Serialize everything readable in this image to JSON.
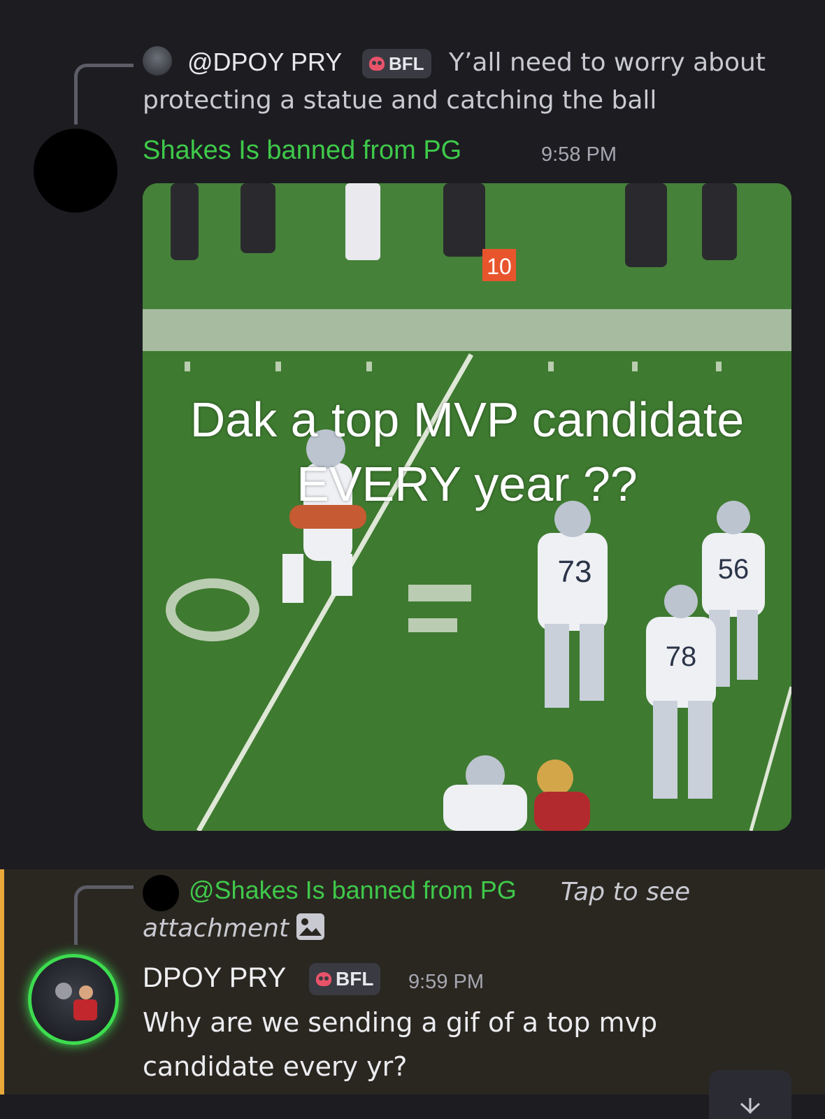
{
  "reply1": {
    "author": "@DPOY PRY",
    "badge": "BFL",
    "text_line1": "Y’all need to worry about",
    "text_line2": "protecting a statue and catching the ball"
  },
  "msg1": {
    "author": "Shakes Is banned from PG",
    "time": "9:58 PM",
    "gif_caption_line1": "Dak a top MVP candidate",
    "gif_caption_line2": "EVERY year ??",
    "gif_jersey_numbers": [
      "10",
      "73",
      "56",
      "78"
    ]
  },
  "reply2": {
    "author": "@Shakes Is banned from PG",
    "text_line1": "Tap to see",
    "text_line2": "attachment"
  },
  "msg2": {
    "author": "DPOY PRY",
    "badge": "BFL",
    "time": "9:59 PM",
    "text_line1": "Why are we sending a gif of a top mvp",
    "text_line2": "candidate every yr?"
  },
  "colors": {
    "background": "#1c1c21",
    "username_green": "#3fc94a",
    "mention_highlight": "#2a2721",
    "mention_bar": "#e8a93a",
    "badge_skull": "#e8536a"
  }
}
